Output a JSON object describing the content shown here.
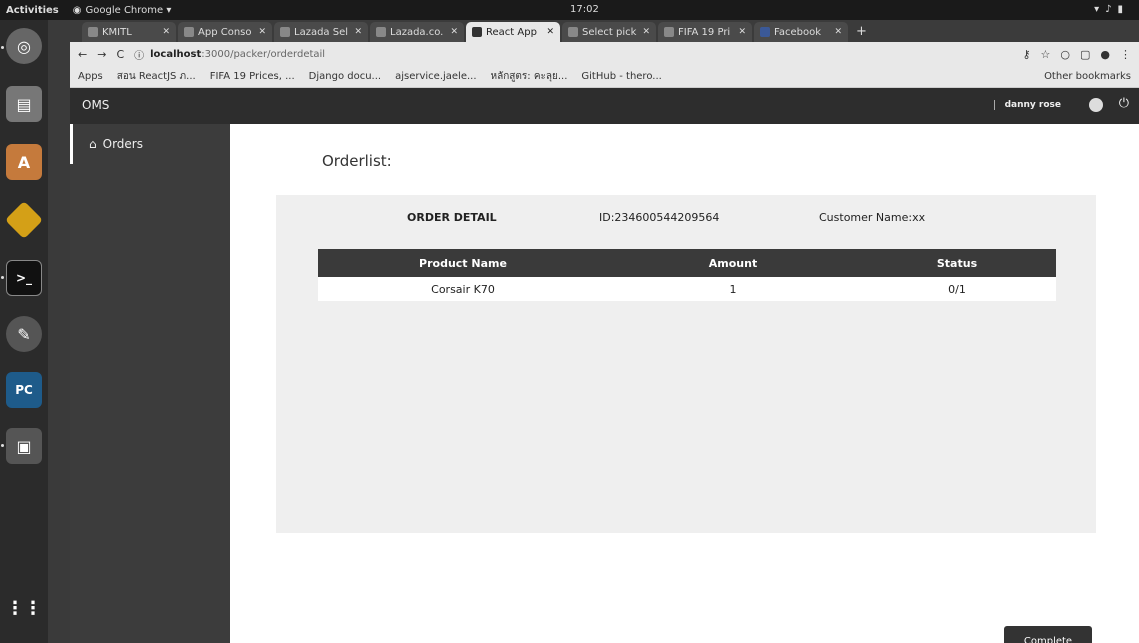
{
  "system": {
    "activities": "Activities",
    "app_menu": "Google Chrome ▾",
    "clock": "17:02"
  },
  "browser": {
    "tabs": [
      {
        "label": "KMITL",
        "active": false
      },
      {
        "label": "App Conso",
        "active": false
      },
      {
        "label": "Lazada Sel",
        "active": false
      },
      {
        "label": "Lazada.co.",
        "active": false
      },
      {
        "label": "React App",
        "active": true
      },
      {
        "label": "Select pick",
        "active": false
      },
      {
        "label": "FIFA 19 Pri",
        "active": false
      },
      {
        "label": "Facebook",
        "active": false
      }
    ],
    "url_host": "localhost",
    "url_path": ":3000/packer/orderdetail",
    "bookmarks": [
      "Apps",
      "สอน ReactJS ภ...",
      "FIFA 19 Prices, ...",
      "Django docu...",
      "ajservice.jaele...",
      "หลักสูตร: คะลุย...",
      "GitHub - thero..."
    ],
    "other_bookmarks": "Other bookmarks"
  },
  "app": {
    "brand": "OMS",
    "user_name": "danny rose",
    "nav": [
      {
        "label": "Orders"
      }
    ],
    "page_title": "Orderlist:",
    "order": {
      "heading": "ORDER DETAIL",
      "id_text": "ID:234600544209564",
      "customer_text": "Customer Name:xx"
    },
    "table": {
      "headers": [
        "Product Name",
        "Amount",
        "Status"
      ],
      "rows": [
        [
          "Corsair K70",
          "1",
          "0/1"
        ]
      ]
    },
    "complete_label": "Complete"
  }
}
